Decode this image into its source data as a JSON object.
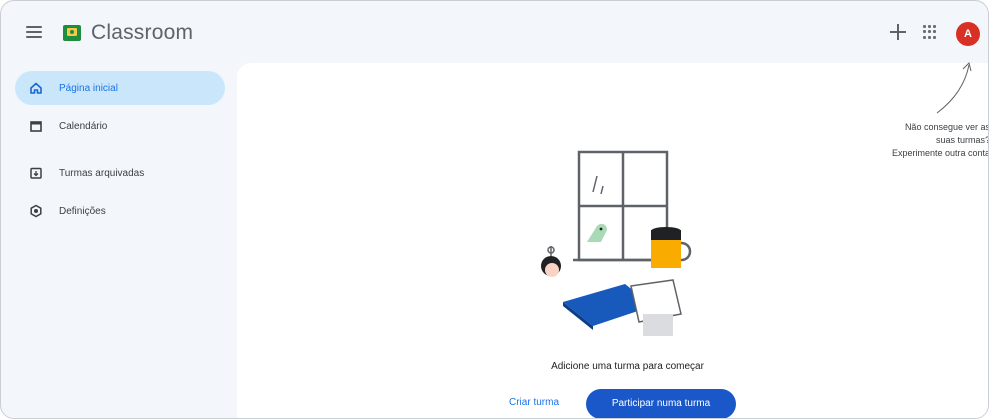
{
  "header": {
    "app_title": "Classroom",
    "avatar_initial": "A"
  },
  "sidebar": {
    "items": [
      {
        "label": "Página inicial",
        "icon": "home-icon",
        "active": true
      },
      {
        "label": "Calendário",
        "icon": "calendar-icon",
        "active": false
      },
      {
        "label": "Turmas arquivadas",
        "icon": "archive-icon",
        "active": false
      },
      {
        "label": "Definições",
        "icon": "gear-icon",
        "active": false
      }
    ]
  },
  "hint": {
    "lines": [
      "Não consegue ver as",
      "suas turmas?",
      "Experimente outra conta"
    ]
  },
  "main": {
    "empty_message": "Adicione uma turma para começar",
    "create_label": "Criar turma",
    "join_label": "Participar numa turma"
  },
  "colors": {
    "accent": "#1a73e8",
    "active_nav": "#c9e6fb",
    "avatar": "#d93025",
    "join_button": "#1a57c8"
  }
}
